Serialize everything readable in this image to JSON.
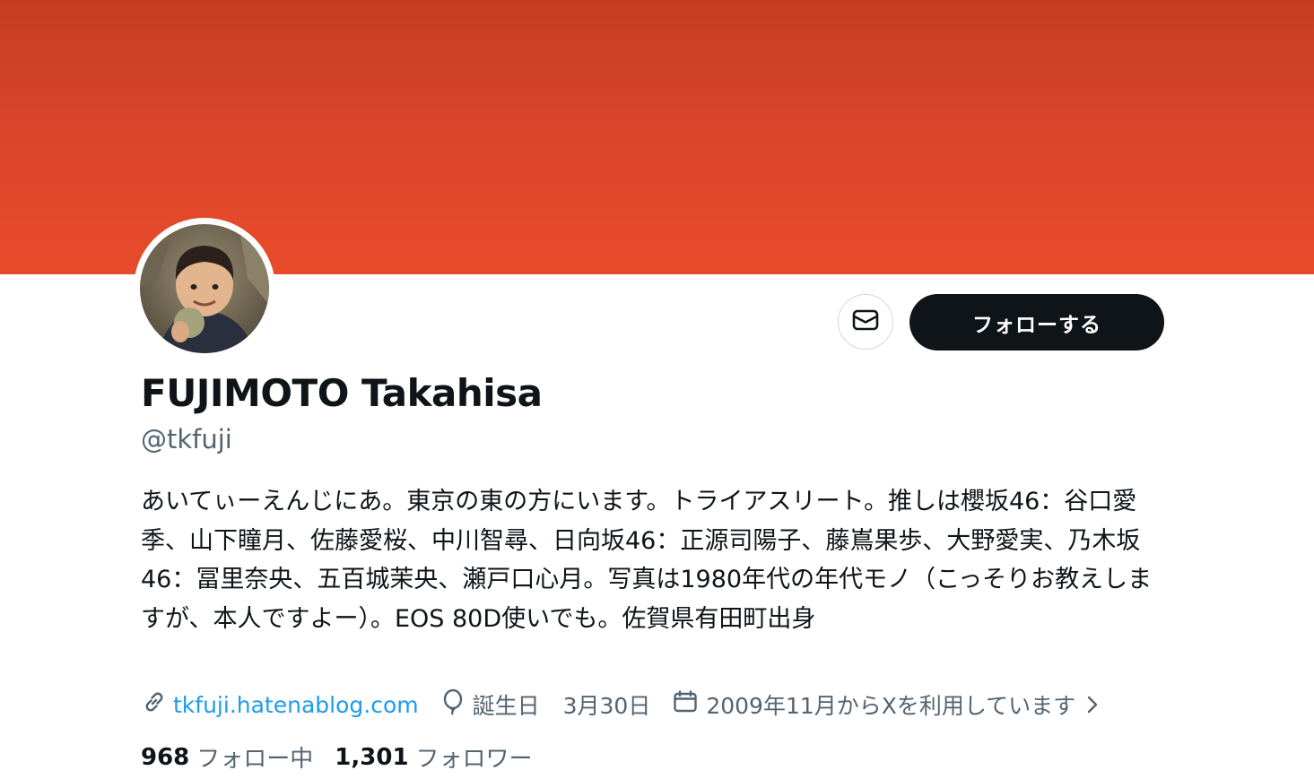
{
  "profile": {
    "display_name": "FUJIMOTO Takahisa",
    "handle": "@tkfuji",
    "bio": "あいてぃーえんじにあ。東京の東の方にいます。トライアスリート。推しは櫻坂46：谷口愛季、山下瞳月、佐藤愛桜、中川智尋、日向坂46：正源司陽子、藤嶌果歩、大野愛実、乃木坂46：冨里奈央、五百城茉央、瀬戸口心月。写真は1980年代の年代モノ（こっそりお教えしますが、本人ですよー）。EOS 80D使いでも。佐賀県有田町出身",
    "website": "tkfuji.hatenablog.com",
    "birthday_label": "誕生日",
    "birthday_value": "3月30日",
    "joined": "2009年11月からXを利用しています"
  },
  "actions": {
    "follow_label": "フォローする"
  },
  "stats": {
    "following_count": "968",
    "following_label": "フォロー中",
    "followers_count": "1,301",
    "followers_label": "フォロワー"
  },
  "icons": {
    "message": "mail-icon",
    "link": "link-icon",
    "birthday": "balloon-icon",
    "joined": "calendar-icon",
    "more": "chevron-right-icon"
  },
  "colors": {
    "banner": "#e04828",
    "follow_button": "#0f1419",
    "link": "#1d9bf0",
    "muted_text": "#536471"
  }
}
